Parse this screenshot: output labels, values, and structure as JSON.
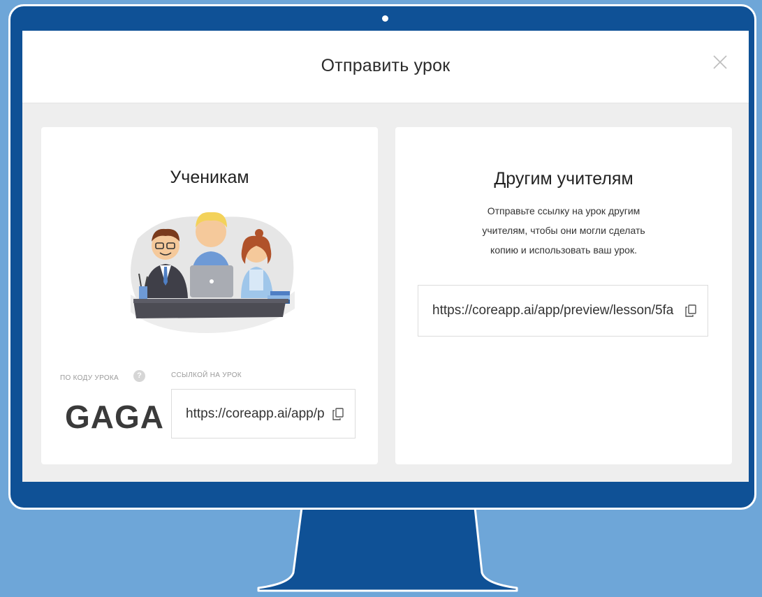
{
  "modal": {
    "title": "Отправить урок"
  },
  "students": {
    "title": "Ученикам",
    "code_label": "ПО КОДУ УРОКА",
    "help": "?",
    "code": "GAGA",
    "link_label": "ССЫЛКОЙ НА УРОК",
    "link": "https://coreapp.ai/app/p"
  },
  "teachers": {
    "title": "Другим учителям",
    "description_lines": [
      "Отправьте ссылку на урок другим",
      "учителям, чтобы они могли сделать",
      "копию и использовать ваш урок."
    ],
    "link": "https://coreapp.ai/app/preview/lesson/5fa"
  },
  "colors": {
    "background": "#6ea6d8",
    "bezel": "#0f5196",
    "screen_bg": "#eeeeee",
    "card_bg": "#ffffff"
  },
  "icons": {
    "close": "close-icon",
    "copy": "copy-icon",
    "help": "help-icon"
  }
}
